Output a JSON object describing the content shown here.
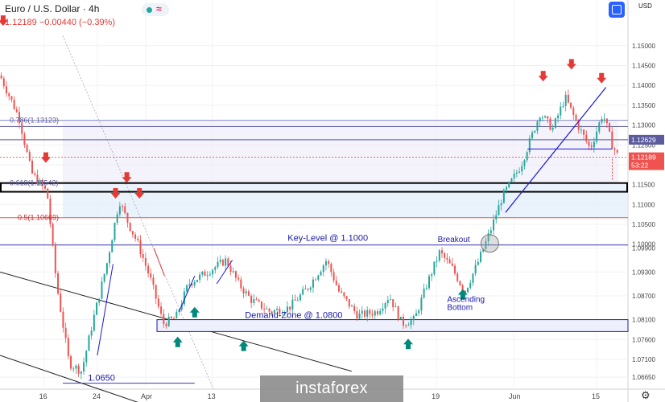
{
  "header": {
    "symbol": "Euro / U.S. Dollar · 4h",
    "quote": "1.12189  −0.00440 (−0.39%)"
  },
  "axis": {
    "currency": "USD"
  },
  "brand": "instaforex",
  "colors": {
    "bull": "#26a69a",
    "bear": "#ef5350",
    "level": "#3a3ab8",
    "fib": "#8a8ac8"
  },
  "icons": {
    "layout": "square-icon",
    "settings": "gear-icon",
    "indicator": "wave-icon"
  },
  "chart_data": {
    "type": "candlestick",
    "title": "Euro / U.S. Dollar · 4h",
    "ylim": [
      1.0635,
      1.1615
    ],
    "grid": true,
    "y_ticks": [
      "1.15000",
      "1.14500",
      "1.14000",
      "1.13500",
      "1.13000",
      "1.12500",
      "1.12000",
      "1.11500",
      "1.11000",
      "1.10500",
      "1.10000",
      "1.09900",
      "1.09300",
      "1.08700",
      "1.08100",
      "1.07600",
      "1.07100",
      "1.06650"
    ],
    "x_ticks": [
      {
        "label": "16",
        "x": 0.07
      },
      {
        "label": "24",
        "x": 0.155
      },
      {
        "label": "Apr",
        "x": 0.232
      },
      {
        "label": "13",
        "x": 0.338
      },
      {
        "label": "19",
        "x": 0.695
      },
      {
        "label": "Jun",
        "x": 0.818
      },
      {
        "label": "15",
        "x": 0.95
      }
    ],
    "price_tags": [
      {
        "text": "1.12629",
        "value": 1.1263,
        "color": "#5b5b9e"
      },
      {
        "text": "1.12189",
        "value": 1.1219,
        "color": "#ef5350"
      },
      {
        "text": "53:22",
        "value": 1.1199,
        "color": "#ef5350"
      }
    ],
    "levels": [
      {
        "label": "Key-Level @ 1.1000",
        "value": 1.0998,
        "color": "#3a3ab8"
      },
      {
        "label": "0.5(1.10669)",
        "value": 1.10669,
        "color": "#ef5350"
      },
      {
        "label": "0.618(1.11542)",
        "value": 1.1154,
        "color": "#8a8ac8"
      },
      {
        "label": "0.786(1.13123)",
        "value": 1.1312,
        "color": "#8a8ac8"
      },
      {
        "label": "1.0650",
        "value": 1.065,
        "color": "#3a3ab8"
      }
    ],
    "zones": [
      {
        "label": "Demand-Zone @ 1.0800",
        "from": 1.078,
        "to": 1.081
      },
      {
        "label": "",
        "from": 1.1132,
        "to": 1.1154
      }
    ],
    "annotations": [
      "Breakout",
      "Ascending Bottom"
    ],
    "close_path": [
      {
        "x": 0.0,
        "y": 1.1425
      },
      {
        "x": 0.03,
        "y": 1.132
      },
      {
        "x": 0.05,
        "y": 1.118
      },
      {
        "x": 0.075,
        "y": 1.113
      },
      {
        "x": 0.09,
        "y": 1.09
      },
      {
        "x": 0.11,
        "y": 1.07
      },
      {
        "x": 0.13,
        "y": 1.068
      },
      {
        "x": 0.15,
        "y": 1.082
      },
      {
        "x": 0.17,
        "y": 1.095
      },
      {
        "x": 0.19,
        "y": 1.111
      },
      {
        "x": 0.205,
        "y": 1.105
      },
      {
        "x": 0.22,
        "y": 1.1
      },
      {
        "x": 0.24,
        "y": 1.091
      },
      {
        "x": 0.26,
        "y": 1.08
      },
      {
        "x": 0.28,
        "y": 1.0815
      },
      {
        "x": 0.3,
        "y": 1.09
      },
      {
        "x": 0.33,
        "y": 1.093
      },
      {
        "x": 0.36,
        "y": 1.096
      },
      {
        "x": 0.38,
        "y": 1.09
      },
      {
        "x": 0.4,
        "y": 1.086
      },
      {
        "x": 0.43,
        "y": 1.083
      },
      {
        "x": 0.46,
        "y": 1.084
      },
      {
        "x": 0.49,
        "y": 1.089
      },
      {
        "x": 0.52,
        "y": 1.096
      },
      {
        "x": 0.54,
        "y": 1.088
      },
      {
        "x": 0.57,
        "y": 1.082
      },
      {
        "x": 0.6,
        "y": 1.083
      },
      {
        "x": 0.62,
        "y": 1.087
      },
      {
        "x": 0.64,
        "y": 1.08
      },
      {
        "x": 0.66,
        "y": 1.081
      },
      {
        "x": 0.68,
        "y": 1.09
      },
      {
        "x": 0.7,
        "y": 1.098
      },
      {
        "x": 0.72,
        "y": 1.094
      },
      {
        "x": 0.74,
        "y": 1.088
      },
      {
        "x": 0.76,
        "y": 1.095
      },
      {
        "x": 0.78,
        "y": 1.103
      },
      {
        "x": 0.8,
        "y": 1.112
      },
      {
        "x": 0.83,
        "y": 1.12
      },
      {
        "x": 0.86,
        "y": 1.133
      },
      {
        "x": 0.88,
        "y": 1.129
      },
      {
        "x": 0.9,
        "y": 1.137
      },
      {
        "x": 0.92,
        "y": 1.13
      },
      {
        "x": 0.94,
        "y": 1.124
      },
      {
        "x": 0.96,
        "y": 1.133
      },
      {
        "x": 0.975,
        "y": 1.125
      },
      {
        "x": 0.985,
        "y": 1.1219
      }
    ]
  }
}
